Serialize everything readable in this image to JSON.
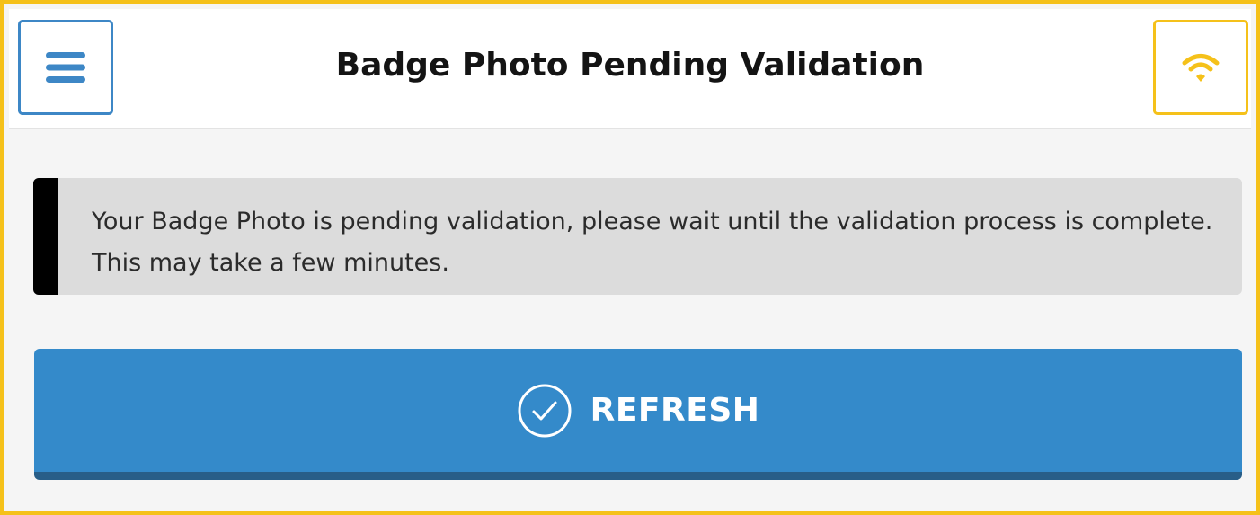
{
  "header": {
    "title": "Badge Photo Pending Validation",
    "menu_icon": "hamburger-menu-icon",
    "network_icon": "wifi-icon"
  },
  "alert": {
    "message": "Your Badge Photo is pending validation, please wait until the validation process is complete. This may take a few minutes."
  },
  "refresh": {
    "label": "REFRESH",
    "icon": "check-circle-icon"
  },
  "colors": {
    "frame_border": "#f5c11a",
    "accent_blue": "#348aca",
    "button_shadow": "#285e88",
    "wifi": "#f5c11a",
    "alert_background": "#dcdcdc",
    "alert_bar": "#000000"
  }
}
